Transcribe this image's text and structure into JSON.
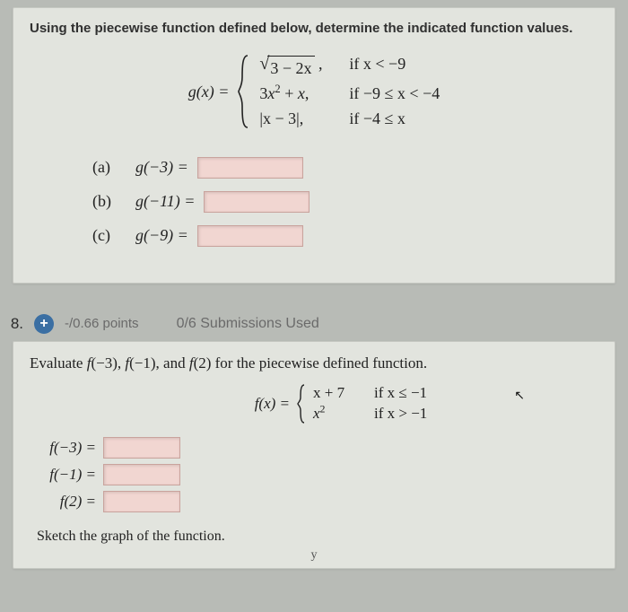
{
  "q7": {
    "prompt": "Using the piecewise function defined below, determine the indicated function values.",
    "func_lhs": "g(x) = ",
    "cases": [
      {
        "expr_pre": "",
        "radicand": "3 − 2x",
        "expr_post": " ,",
        "cond": "if x < −9",
        "is_sqrt": true
      },
      {
        "expr": "3x² + x,",
        "cond": "if −9 ≤ x < −4"
      },
      {
        "expr": "|x − 3|,",
        "cond": "if −4 ≤ x"
      }
    ],
    "parts": [
      {
        "label": "(a)",
        "eq": "g(−3) ="
      },
      {
        "label": "(b)",
        "eq": "g(−11) ="
      },
      {
        "label": "(c)",
        "eq": "g(−9) ="
      }
    ]
  },
  "qheader": {
    "number": "8.",
    "plus": "+",
    "points": "-/0.66 points",
    "submissions": "0/6 Submissions Used"
  },
  "q8": {
    "prompt": "Evaluate f(−3), f(−1), and f(2) for the piecewise defined function.",
    "func_lhs": "f(x) = ",
    "cases": [
      {
        "expr": "x + 7",
        "cond": "if x ≤ −1"
      },
      {
        "expr": "x²",
        "cond": "if x > −1"
      }
    ],
    "parts": [
      {
        "lhs": "f(−3) ="
      },
      {
        "lhs": "f(−1) ="
      },
      {
        "lhs": "f(2) ="
      }
    ],
    "sketch": "Sketch the graph of the function.",
    "axis": "y"
  }
}
